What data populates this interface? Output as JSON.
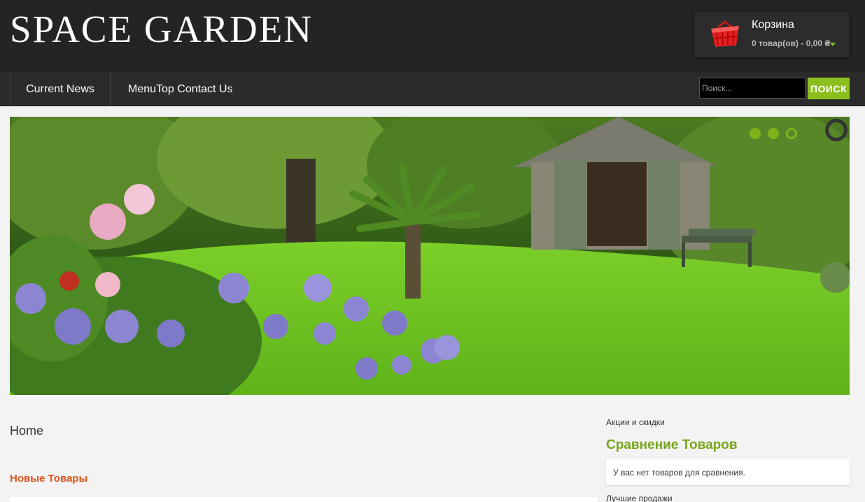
{
  "header": {
    "logo_text": "SPACE GARDEN",
    "cart": {
      "icon": "basket-icon",
      "title": "Корзина",
      "summary": "0 товар(ов) - 0,00 ₴"
    }
  },
  "nav": {
    "items": [
      {
        "label": "Current News"
      },
      {
        "label": "MenuTop Contact Us"
      }
    ],
    "search": {
      "placeholder": "Поиск...",
      "button_label": "ПОИСК"
    }
  },
  "slider": {
    "dots": 3,
    "active_dot": 3,
    "image_description_icon": "garden-photo"
  },
  "content": {
    "page_title": "Home",
    "section_title": "Новые Товары"
  },
  "sidebar": {
    "link_specials": "Акции и скидки",
    "compare": {
      "title": "Сравнение Товаров",
      "empty_text": "У вас нет товаров для сравнения."
    },
    "link_bestsellers": "Лучшие продажи"
  },
  "colors": {
    "accent_green": "#8cbf1e",
    "section_orange": "#e0521a",
    "header_bg": "#242424"
  }
}
